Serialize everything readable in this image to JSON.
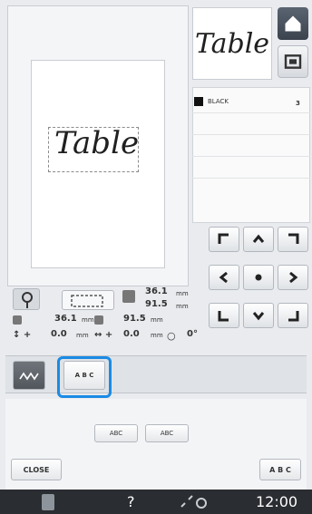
{
  "canvas": {
    "pattern_text": "Table"
  },
  "preview": {
    "pattern_text": "Table"
  },
  "colors": {
    "items": [
      {
        "name": "BLACK",
        "swatch": "#111111"
      }
    ],
    "count_label": "3"
  },
  "size_info": {
    "width_top": "36.1",
    "height_top": "91.5",
    "unit": "mm",
    "width": "36.1",
    "height": "91.5",
    "x_offset": "0.0",
    "y_offset": "0.0",
    "rotation": "0°"
  },
  "toolbar": {
    "abc_button_label": "A B C"
  },
  "array_options": [
    {
      "label": "ABC"
    },
    {
      "label": "ABC"
    }
  ],
  "buttons": {
    "close": "CLOSE",
    "abc": "A B C"
  },
  "status": {
    "help": "?",
    "time": "12:00"
  },
  "accent": "#1b8be5"
}
